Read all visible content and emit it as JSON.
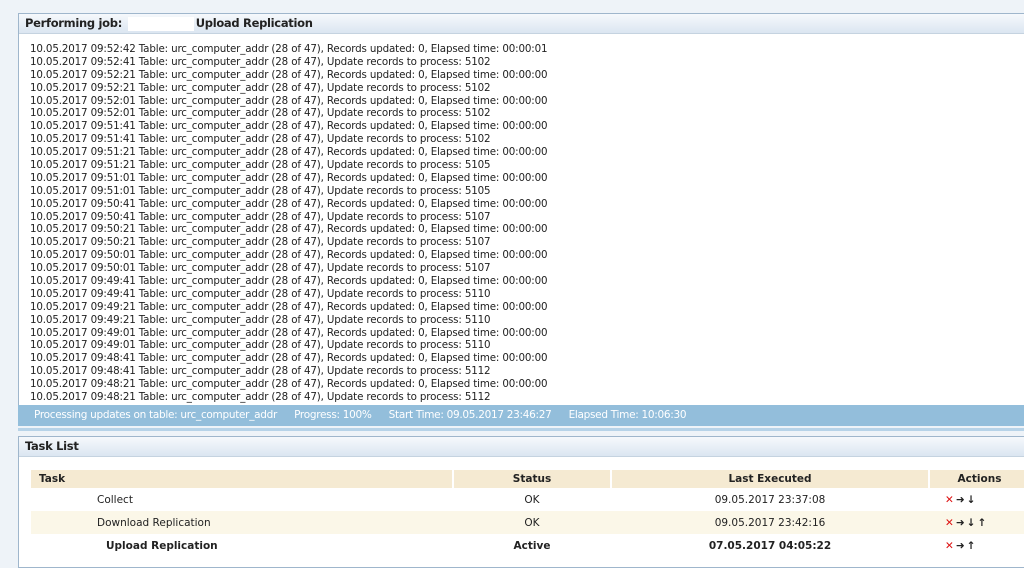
{
  "job": {
    "title_prefix": "Performing job:",
    "title_job": "Upload Replication",
    "log": [
      "10.05.2017 09:52:42 Table: urc_computer_addr (28 of 47), Records updated: 0, Elapsed time: 00:00:01",
      "10.05.2017 09:52:41 Table: urc_computer_addr (28 of 47), Update records to process: 5102",
      "10.05.2017 09:52:21 Table: urc_computer_addr (28 of 47), Records updated: 0, Elapsed time: 00:00:00",
      "10.05.2017 09:52:21 Table: urc_computer_addr (28 of 47), Update records to process: 5102",
      "10.05.2017 09:52:01 Table: urc_computer_addr (28 of 47), Records updated: 0, Elapsed time: 00:00:00",
      "10.05.2017 09:52:01 Table: urc_computer_addr (28 of 47), Update records to process: 5102",
      "10.05.2017 09:51:41 Table: urc_computer_addr (28 of 47), Records updated: 0, Elapsed time: 00:00:00",
      "10.05.2017 09:51:41 Table: urc_computer_addr (28 of 47), Update records to process: 5102",
      "10.05.2017 09:51:21 Table: urc_computer_addr (28 of 47), Records updated: 0, Elapsed time: 00:00:00",
      "10.05.2017 09:51:21 Table: urc_computer_addr (28 of 47), Update records to process: 5105",
      "10.05.2017 09:51:01 Table: urc_computer_addr (28 of 47), Records updated: 0, Elapsed time: 00:00:00",
      "10.05.2017 09:51:01 Table: urc_computer_addr (28 of 47), Update records to process: 5105",
      "10.05.2017 09:50:41 Table: urc_computer_addr (28 of 47), Records updated: 0, Elapsed time: 00:00:00",
      "10.05.2017 09:50:41 Table: urc_computer_addr (28 of 47), Update records to process: 5107",
      "10.05.2017 09:50:21 Table: urc_computer_addr (28 of 47), Records updated: 0, Elapsed time: 00:00:00",
      "10.05.2017 09:50:21 Table: urc_computer_addr (28 of 47), Update records to process: 5107",
      "10.05.2017 09:50:01 Table: urc_computer_addr (28 of 47), Records updated: 0, Elapsed time: 00:00:00",
      "10.05.2017 09:50:01 Table: urc_computer_addr (28 of 47), Update records to process: 5107",
      "10.05.2017 09:49:41 Table: urc_computer_addr (28 of 47), Records updated: 0, Elapsed time: 00:00:00",
      "10.05.2017 09:49:41 Table: urc_computer_addr (28 of 47), Update records to process: 5110",
      "10.05.2017 09:49:21 Table: urc_computer_addr (28 of 47), Records updated: 0, Elapsed time: 00:00:00",
      "10.05.2017 09:49:21 Table: urc_computer_addr (28 of 47), Update records to process: 5110",
      "10.05.2017 09:49:01 Table: urc_computer_addr (28 of 47), Records updated: 0, Elapsed time: 00:00:00",
      "10.05.2017 09:49:01 Table: urc_computer_addr (28 of 47), Update records to process: 5110",
      "10.05.2017 09:48:41 Table: urc_computer_addr (28 of 47), Records updated: 0, Elapsed time: 00:00:00",
      "10.05.2017 09:48:41 Table: urc_computer_addr (28 of 47), Update records to process: 5112",
      "10.05.2017 09:48:21 Table: urc_computer_addr (28 of 47), Records updated: 0, Elapsed time: 00:00:00",
      "10.05.2017 09:48:21 Table: urc_computer_addr (28 of 47), Update records to process: 5112"
    ]
  },
  "status": {
    "table": "Processing updates on table: urc_computer_addr",
    "progress": "Progress: 100%",
    "start": "Start Time: 09.05.2017 23:46:27",
    "elapsed": "Elapsed Time: 10:06:30",
    "progress_value": 100
  },
  "tasks": {
    "title": "Task List",
    "columns": [
      "Task",
      "Status",
      "Last Executed",
      "Actions"
    ],
    "rows": [
      {
        "task": "Collect",
        "status": "OK",
        "last": "09.05.2017 23:37:08",
        "actions": [
          "delete",
          "run",
          "download"
        ]
      },
      {
        "task": "Download Replication",
        "status": "OK",
        "last": "09.05.2017 23:42:16",
        "actions": [
          "delete",
          "run",
          "download",
          "upload"
        ]
      },
      {
        "task": "Upload Replication",
        "status": "Active",
        "last": "07.05.2017 04:05:22",
        "actions": [
          "delete",
          "run",
          "upload"
        ]
      }
    ]
  },
  "colors": {
    "status_bar": "#93bedb",
    "delete": "#dd1111"
  }
}
